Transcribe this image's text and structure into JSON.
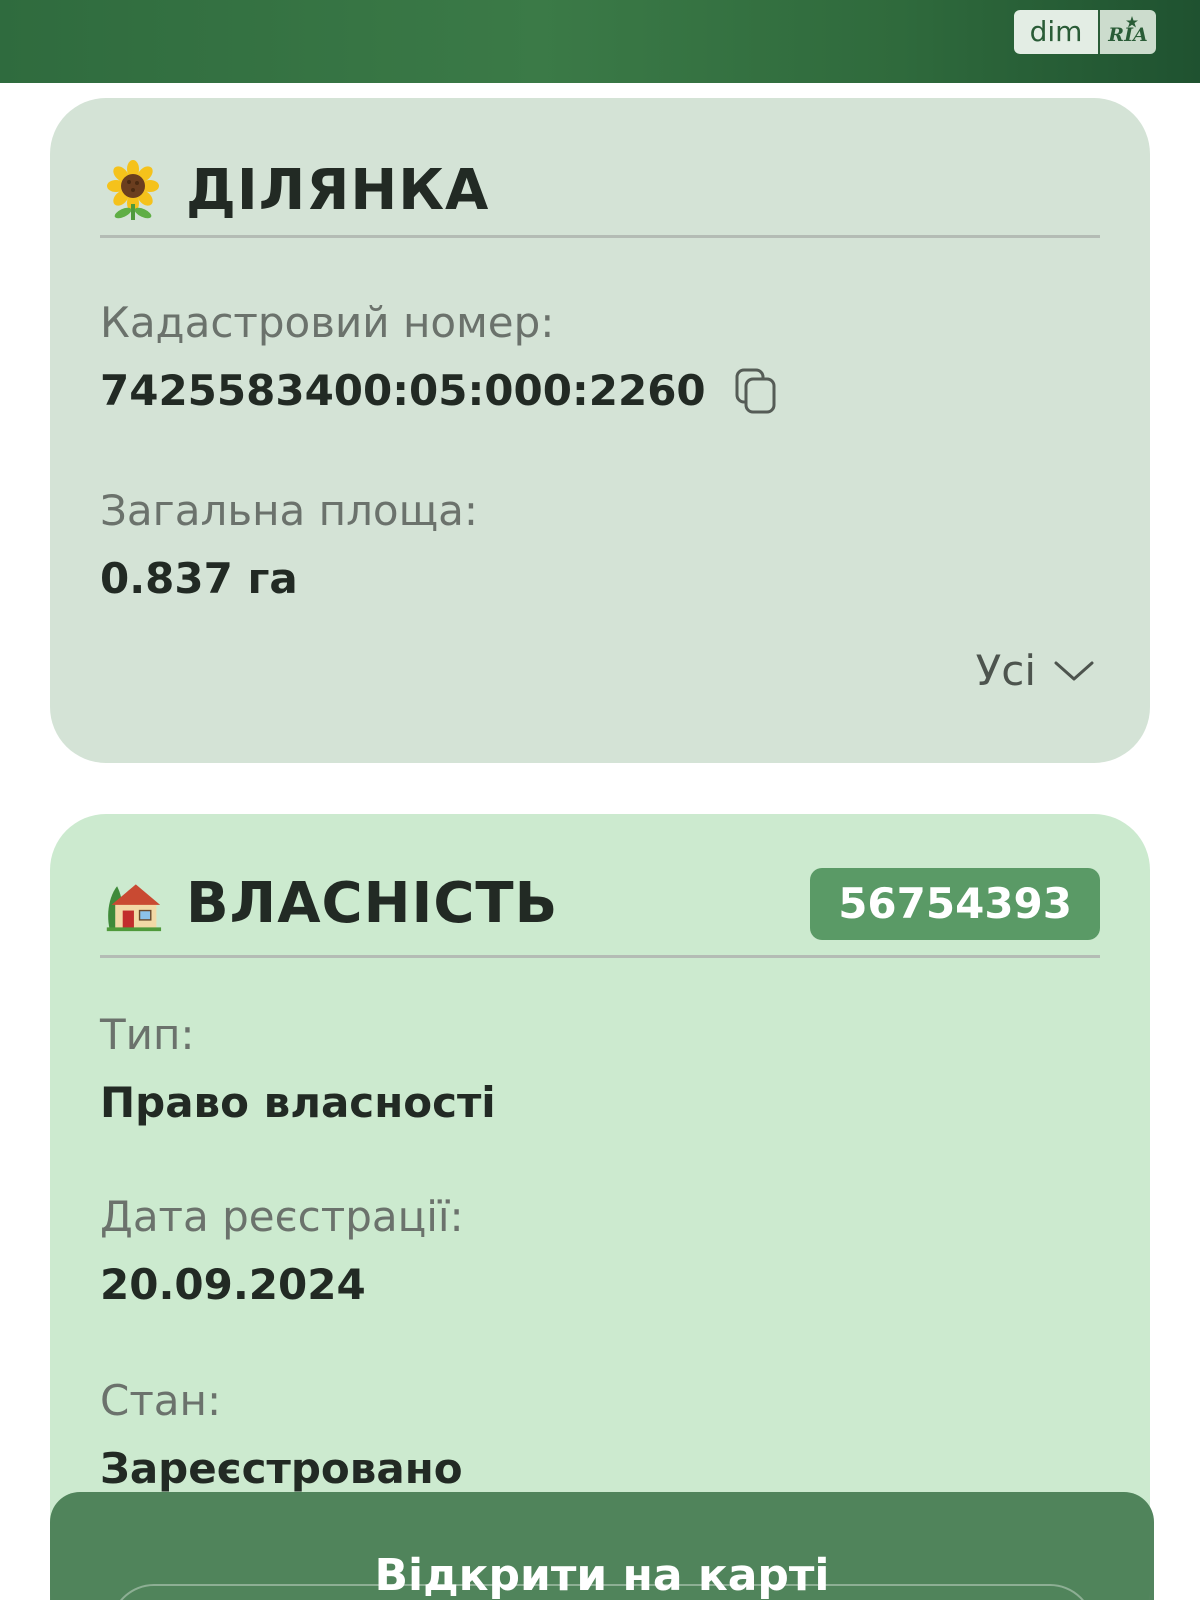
{
  "header": {
    "logo": {
      "left": "dim",
      "right": "RIA"
    }
  },
  "plot_card": {
    "icon": "sunflower-icon",
    "title": "ДІЛЯНКА",
    "cadastral_label": "Кадастровий номер:",
    "cadastral_value": "7425583400:05:000:2260",
    "copy_icon": "copy-icon",
    "area_label": "Загальна площа:",
    "area_value": "0.837 га",
    "more_label": "Усі",
    "more_icon": "chevron-down-icon"
  },
  "ownership_card": {
    "icon": "house-icon",
    "title": "ВЛАСНІСТЬ",
    "badge": "56754393",
    "type_label": "Тип:",
    "type_value": "Право власності",
    "date_label": "Дата реєстрації:",
    "date_value": "20.09.2024",
    "status_label": "Стан:",
    "status_value": "Зареєстровано"
  },
  "bottom": {
    "open_map_label": "Відкрити на карті"
  },
  "colors": {
    "header_green": "#2f6b3e",
    "plot_card_bg": "#d4e3d6",
    "ownership_card_bg": "#cceacf",
    "badge_bg": "#5a9a66",
    "bottom_bar_bg": "#467c52"
  }
}
